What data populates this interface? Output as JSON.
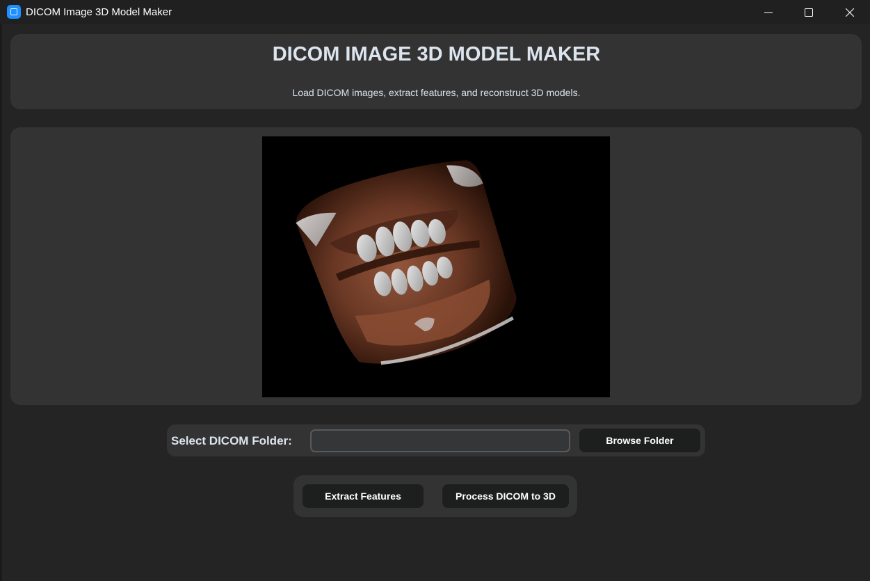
{
  "window": {
    "title": "DICOM Image 3D Model Maker",
    "icons": {
      "app": "app-icon",
      "minimize": "minimize-icon",
      "maximize": "maximize-icon",
      "close": "close-icon"
    }
  },
  "header": {
    "title": "DICOM IMAGE 3D MODEL MAKER",
    "subtitle": "Load DICOM images, extract features, and reconstruct 3D models."
  },
  "preview": {
    "content": "3D volume rendering of a dental/jaw CT scan"
  },
  "folder": {
    "label": "Select DICOM Folder:",
    "value": "",
    "placeholder": "",
    "browse_label": "Browse Folder"
  },
  "actions": {
    "extract_label": "Extract Features",
    "process_label": "Process DICOM to 3D"
  },
  "colors": {
    "background": "#242424",
    "titlebar": "#202020",
    "panel": "#333333",
    "button": "#1d1e1e",
    "text": "#dce4ee",
    "accent": "#1e90ff"
  }
}
